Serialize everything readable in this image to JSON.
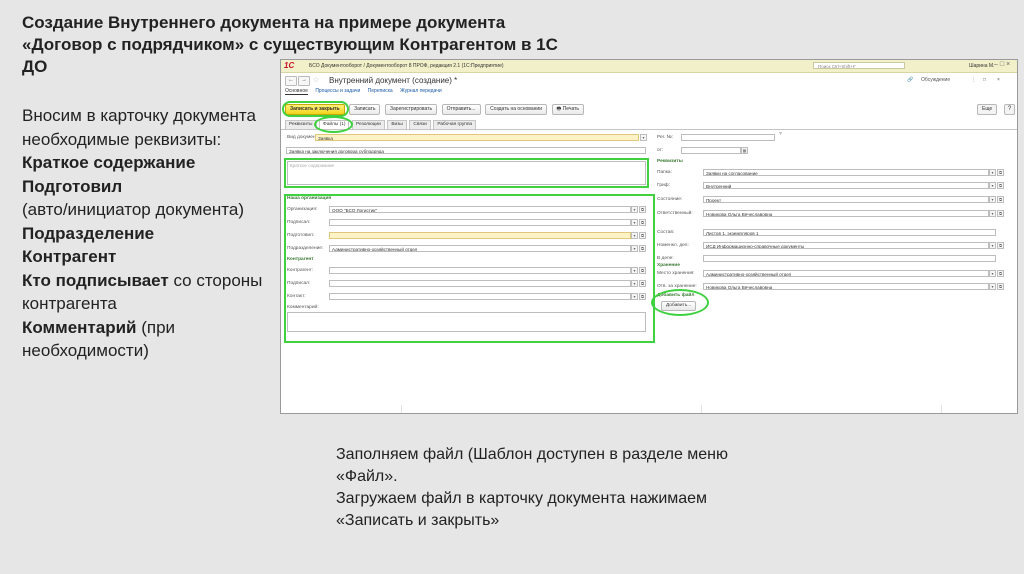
{
  "slide": {
    "title_lines": [
      "Создание Внутреннего документа на примере документа",
      "«Договор с подрядчиком» с существующим Контрагентом в 1С",
      "ДО"
    ],
    "left": {
      "intro": "Вносим в карточку документа необходимые реквизиты:",
      "item1": "Краткое содержание",
      "item2_bold": "Подготовил",
      "item2_rest": "(авто/инициатор документа)",
      "item3": "Подразделение",
      "item4": "Контрагент",
      "item5_bold": "Кто подписывает",
      "item5_rest": "со стороны контрагента",
      "item6_bold": "Комментарий",
      "item6_rest": "(при необходимости)"
    },
    "bottom_lines": [
      "Заполняем файл (Шаблон доступен в разделе меню",
      "«Файл».",
      "Загружаем файл в карточку документа нажимаем",
      "«Записать и закрыть»"
    ]
  },
  "app": {
    "logo": "1С",
    "title": "БСО Документооборот / Документооборот 8 ПРОФ, редакция 2.1  (1С:Предприятие)",
    "search_placeholder": "Поиск Ctrl+Shift+F",
    "user": "Шарина М.",
    "doc_title": "Внутренний документ (создание) *",
    "discussion": "Обсуждение",
    "nav_tabs": [
      "Основное",
      "Процессы и задачи",
      "Переписка",
      "Журнал передачи"
    ],
    "toolbar": {
      "save_close": "Записать и закрыть",
      "save": "Записать",
      "register": "Зарегистрировать",
      "send": "Отправить...",
      "create_basis": "Создать на основании",
      "print": "Печать",
      "more": "Еще",
      "help": "?"
    },
    "form_tabs": [
      "Реквизиты",
      "Файлы (1)",
      "Резолюции",
      "Визы",
      "Связи",
      "Рабочая группа"
    ],
    "left_form": {
      "doc_type_label": "Вид документа",
      "doc_type_value": "Заявка",
      "title_value": "Заявка на заключения договора субподрядa",
      "summary_placeholder": "Краткое содержание",
      "org_section": "Наша организация",
      "org_label": "Организация:",
      "org_value": "ООО \"БСО Логистик\"",
      "signed_label": "Подписал:",
      "prepared_label": "Подготовил:",
      "dept_label": "Подразделение:",
      "dept_value": "Административно-хозяйственный отдел",
      "contractor_section": "Контрагент",
      "contractor_label": "Контрагент:",
      "signs_label": "Подписал:",
      "contact_label": "Контакт:",
      "comment_label": "Комментарий:"
    },
    "right_form": {
      "reg_no_label": "Рег. №:",
      "from_label": "от:",
      "req_section": "Реквизиты",
      "folder_label": "Папка:",
      "folder_value": "Заявки на согласование",
      "stamp_label": "Гриф:",
      "stamp_value": "Внутренний",
      "state_label": "Состояние:",
      "state_value": "Проект",
      "resp_label": "Ответственный:",
      "resp_value": "Новикова Ольга Вячеславовна",
      "content_label": "Состав:",
      "content_value": "Листов 1, экземпляров 1",
      "nomen_label": "Номенкл. дел:",
      "nomen_value": "ИСД Информационно-справочные документы",
      "in_case_label": "В деле:",
      "storage_section": "Хранение",
      "place_label": "Место хранения:",
      "place_value": "Административно-хозяйственный отдел",
      "resp_store_label": "Отв. за хранение:",
      "resp_store_value": "Новикова Ольга Вячеславовна",
      "add_file_section": "Добавить файл",
      "add_btn": "Добавить..."
    }
  }
}
